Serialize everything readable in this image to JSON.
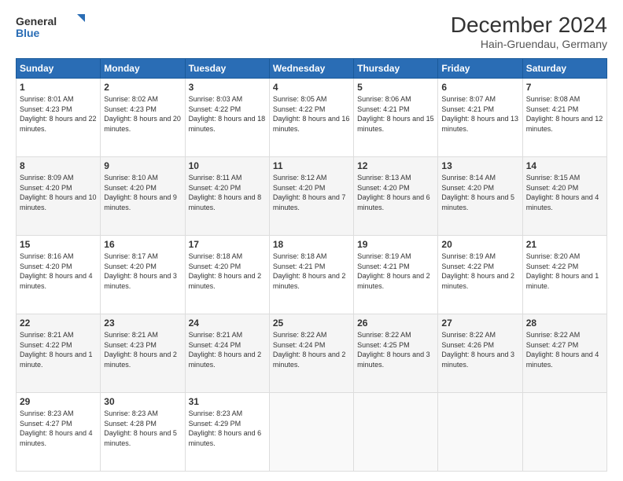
{
  "header": {
    "logo_line1": "General",
    "logo_line2": "Blue",
    "title": "December 2024",
    "subtitle": "Hain-Gruendau, Germany"
  },
  "calendar": {
    "days_of_week": [
      "Sunday",
      "Monday",
      "Tuesday",
      "Wednesday",
      "Thursday",
      "Friday",
      "Saturday"
    ],
    "weeks": [
      [
        {
          "day": "1",
          "sunrise": "8:01 AM",
          "sunset": "4:23 PM",
          "daylight": "8 hours and 22 minutes."
        },
        {
          "day": "2",
          "sunrise": "8:02 AM",
          "sunset": "4:23 PM",
          "daylight": "8 hours and 20 minutes."
        },
        {
          "day": "3",
          "sunrise": "8:03 AM",
          "sunset": "4:22 PM",
          "daylight": "8 hours and 18 minutes."
        },
        {
          "day": "4",
          "sunrise": "8:05 AM",
          "sunset": "4:22 PM",
          "daylight": "8 hours and 16 minutes."
        },
        {
          "day": "5",
          "sunrise": "8:06 AM",
          "sunset": "4:21 PM",
          "daylight": "8 hours and 15 minutes."
        },
        {
          "day": "6",
          "sunrise": "8:07 AM",
          "sunset": "4:21 PM",
          "daylight": "8 hours and 13 minutes."
        },
        {
          "day": "7",
          "sunrise": "8:08 AM",
          "sunset": "4:21 PM",
          "daylight": "8 hours and 12 minutes."
        }
      ],
      [
        {
          "day": "8",
          "sunrise": "8:09 AM",
          "sunset": "4:20 PM",
          "daylight": "8 hours and 10 minutes."
        },
        {
          "day": "9",
          "sunrise": "8:10 AM",
          "sunset": "4:20 PM",
          "daylight": "8 hours and 9 minutes."
        },
        {
          "day": "10",
          "sunrise": "8:11 AM",
          "sunset": "4:20 PM",
          "daylight": "8 hours and 8 minutes."
        },
        {
          "day": "11",
          "sunrise": "8:12 AM",
          "sunset": "4:20 PM",
          "daylight": "8 hours and 7 minutes."
        },
        {
          "day": "12",
          "sunrise": "8:13 AM",
          "sunset": "4:20 PM",
          "daylight": "8 hours and 6 minutes."
        },
        {
          "day": "13",
          "sunrise": "8:14 AM",
          "sunset": "4:20 PM",
          "daylight": "8 hours and 5 minutes."
        },
        {
          "day": "14",
          "sunrise": "8:15 AM",
          "sunset": "4:20 PM",
          "daylight": "8 hours and 4 minutes."
        }
      ],
      [
        {
          "day": "15",
          "sunrise": "8:16 AM",
          "sunset": "4:20 PM",
          "daylight": "8 hours and 4 minutes."
        },
        {
          "day": "16",
          "sunrise": "8:17 AM",
          "sunset": "4:20 PM",
          "daylight": "8 hours and 3 minutes."
        },
        {
          "day": "17",
          "sunrise": "8:18 AM",
          "sunset": "4:20 PM",
          "daylight": "8 hours and 2 minutes."
        },
        {
          "day": "18",
          "sunrise": "8:18 AM",
          "sunset": "4:21 PM",
          "daylight": "8 hours and 2 minutes."
        },
        {
          "day": "19",
          "sunrise": "8:19 AM",
          "sunset": "4:21 PM",
          "daylight": "8 hours and 2 minutes."
        },
        {
          "day": "20",
          "sunrise": "8:19 AM",
          "sunset": "4:22 PM",
          "daylight": "8 hours and 2 minutes."
        },
        {
          "day": "21",
          "sunrise": "8:20 AM",
          "sunset": "4:22 PM",
          "daylight": "8 hours and 1 minute."
        }
      ],
      [
        {
          "day": "22",
          "sunrise": "8:21 AM",
          "sunset": "4:22 PM",
          "daylight": "8 hours and 1 minute."
        },
        {
          "day": "23",
          "sunrise": "8:21 AM",
          "sunset": "4:23 PM",
          "daylight": "8 hours and 2 minutes."
        },
        {
          "day": "24",
          "sunrise": "8:21 AM",
          "sunset": "4:24 PM",
          "daylight": "8 hours and 2 minutes."
        },
        {
          "day": "25",
          "sunrise": "8:22 AM",
          "sunset": "4:24 PM",
          "daylight": "8 hours and 2 minutes."
        },
        {
          "day": "26",
          "sunrise": "8:22 AM",
          "sunset": "4:25 PM",
          "daylight": "8 hours and 3 minutes."
        },
        {
          "day": "27",
          "sunrise": "8:22 AM",
          "sunset": "4:26 PM",
          "daylight": "8 hours and 3 minutes."
        },
        {
          "day": "28",
          "sunrise": "8:22 AM",
          "sunset": "4:27 PM",
          "daylight": "8 hours and 4 minutes."
        }
      ],
      [
        {
          "day": "29",
          "sunrise": "8:23 AM",
          "sunset": "4:27 PM",
          "daylight": "8 hours and 4 minutes."
        },
        {
          "day": "30",
          "sunrise": "8:23 AM",
          "sunset": "4:28 PM",
          "daylight": "8 hours and 5 minutes."
        },
        {
          "day": "31",
          "sunrise": "8:23 AM",
          "sunset": "4:29 PM",
          "daylight": "8 hours and 6 minutes."
        },
        null,
        null,
        null,
        null
      ]
    ]
  }
}
